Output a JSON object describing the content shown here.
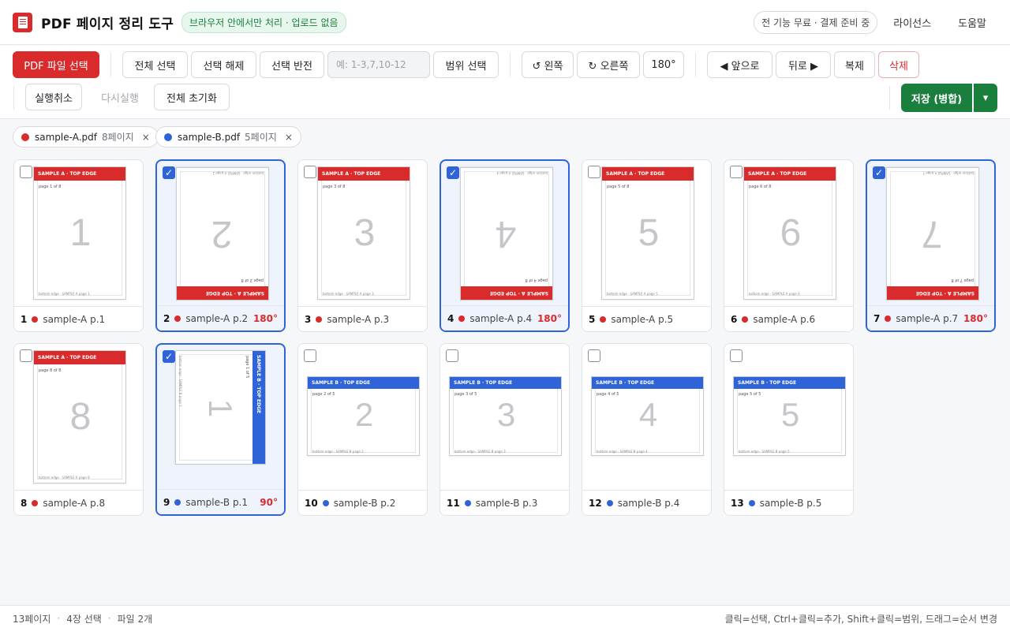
{
  "header": {
    "title": "PDF 페이지 정리 도구",
    "privacy_badge": "브라우저 안에서만 처리 · 업로드 없음",
    "free_notice": "전 기능 무료 · 결제 준비 중",
    "license_link": "라이선스",
    "help_link": "도움말"
  },
  "toolbar": {
    "choose_pdf": "PDF 파일 선택",
    "select_all": "전체 선택",
    "deselect": "선택 해제",
    "invert": "선택 반전",
    "range_placeholder": "예: 1-3,7,10-12",
    "range_select": "범위 선택",
    "rotate_left": "↺ 왼쪽",
    "rotate_right": "↻ 오른쪽",
    "rotate_180": "180°",
    "move_forward": "◀ 앞으로",
    "move_back": "뒤로 ▶",
    "duplicate": "복제",
    "delete": "삭제",
    "undo": "실행취소",
    "redo": "다시실행",
    "reset_all": "전체 초기화",
    "save": "저장 (병합)",
    "save_menu": "▾"
  },
  "files": [
    {
      "name": "sample-A.pdf",
      "pages": "8페이지",
      "color": "#d92b2b",
      "close": "×"
    },
    {
      "name": "sample-B.pdf",
      "pages": "5페이지",
      "color": "#2f64d8",
      "close": "×"
    }
  ],
  "pages": [
    {
      "index": "1",
      "label": "sample-A p.1",
      "file": "A",
      "page": 1,
      "rotation": "",
      "selected": false
    },
    {
      "index": "2",
      "label": "sample-A p.2",
      "file": "A",
      "page": 2,
      "rotation": "180°",
      "selected": true
    },
    {
      "index": "3",
      "label": "sample-A p.3",
      "file": "A",
      "page": 3,
      "rotation": "",
      "selected": false
    },
    {
      "index": "4",
      "label": "sample-A p.4",
      "file": "A",
      "page": 4,
      "rotation": "180°",
      "selected": true
    },
    {
      "index": "5",
      "label": "sample-A p.5",
      "file": "A",
      "page": 5,
      "rotation": "",
      "selected": false
    },
    {
      "index": "6",
      "label": "sample-A p.6",
      "file": "A",
      "page": 6,
      "rotation": "",
      "selected": false
    },
    {
      "index": "7",
      "label": "sample-A p.7",
      "file": "A",
      "page": 7,
      "rotation": "180°",
      "selected": true
    },
    {
      "index": "8",
      "label": "sample-A p.8",
      "file": "A",
      "page": 8,
      "rotation": "",
      "selected": false
    },
    {
      "index": "9",
      "label": "sample-B p.1",
      "file": "B",
      "page": 1,
      "rotation": "90°",
      "selected": true
    },
    {
      "index": "10",
      "label": "sample-B p.2",
      "file": "B",
      "page": 2,
      "rotation": "",
      "selected": false
    },
    {
      "index": "11",
      "label": "sample-B p.3",
      "file": "B",
      "page": 3,
      "rotation": "",
      "selected": false
    },
    {
      "index": "12",
      "label": "sample-B p.4",
      "file": "B",
      "page": 4,
      "rotation": "",
      "selected": false
    },
    {
      "index": "13",
      "label": "sample-B p.5",
      "file": "B",
      "page": 5,
      "rotation": "",
      "selected": false
    }
  ],
  "thumb_text": {
    "A": {
      "band": "SAMPLE A · TOP EDGE",
      "page_of": "page {n} of 8",
      "bottom": "bottom edge · SAMPLE A page {n}"
    },
    "B": {
      "band": "SAMPLE B · TOP EDGE",
      "page_of": "page {n} of 5",
      "bottom": "bottom edge · SAMPLE B page {n}"
    }
  },
  "status": {
    "page_count": "13페이지",
    "selected_count": "4장 선택",
    "file_count": "파일 2개",
    "hint": "클릭=선택, Ctrl+클릭=추가, Shift+클릭=범위, 드래그=순서 변경"
  },
  "colors": {
    "file_A": "#d92b2b",
    "file_B": "#2f64d8",
    "selected": "#2f64d8",
    "save": "#1a7f3c"
  }
}
